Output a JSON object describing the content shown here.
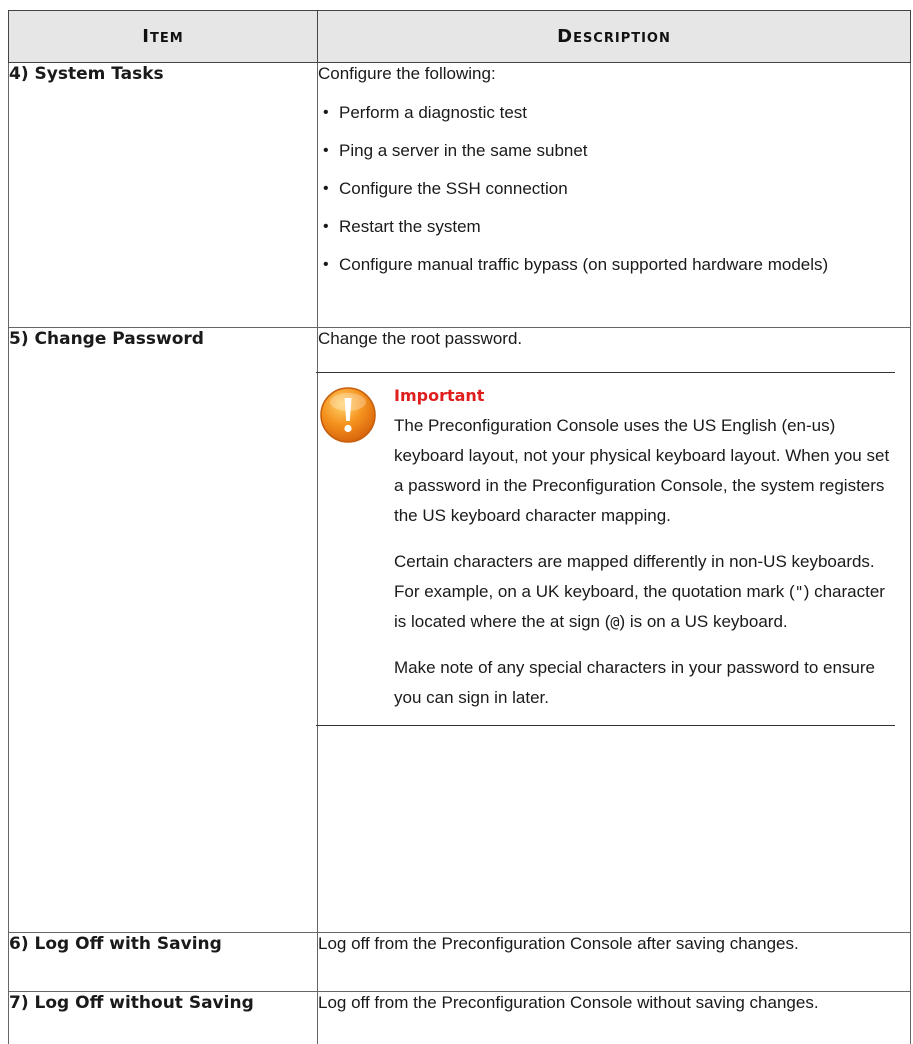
{
  "table": {
    "headers": {
      "item": "Item",
      "description": "Description"
    },
    "rows": [
      {
        "item": "4) System Tasks",
        "intro": "Configure the following:",
        "bullets": [
          "Perform a diagnostic test",
          "Ping a server in the same subnet",
          "Configure the SSH connection",
          "Restart the system",
          "Configure manual traffic bypass (on supported hardware models)"
        ]
      },
      {
        "item": "5) Change Password",
        "intro": "Change the root password.",
        "note": {
          "icon": "warning-icon",
          "title": "Important",
          "paragraph1": "The Preconfiguration Console uses the US English (en-us) keyboard layout, not your physical keyboard layout. When you set a password in the Preconfiguration Console, the system registers the US keyboard character mapping.",
          "paragraph2_a": "Certain characters are mapped differently in non-US keyboards. For example, on a UK keyboard, the quotation mark (",
          "paragraph2_quote": "\"",
          "paragraph2_b": ") character is located where the at sign (",
          "paragraph2_at": "@",
          "paragraph2_c": ") is on a US keyboard.",
          "paragraph3": "Make note of any special characters in your password to ensure you can sign in later."
        }
      },
      {
        "item": "6) Log Off with Saving",
        "description": "Log off from the Preconfiguration Console after saving changes."
      },
      {
        "item": "7) Log Off without Saving",
        "description": "Log off from the Preconfiguration Console without saving changes."
      }
    ]
  },
  "colors": {
    "header_bg": "#e6e6e6",
    "important": "#e01e1e",
    "warning_icon": "#f08a1c"
  }
}
